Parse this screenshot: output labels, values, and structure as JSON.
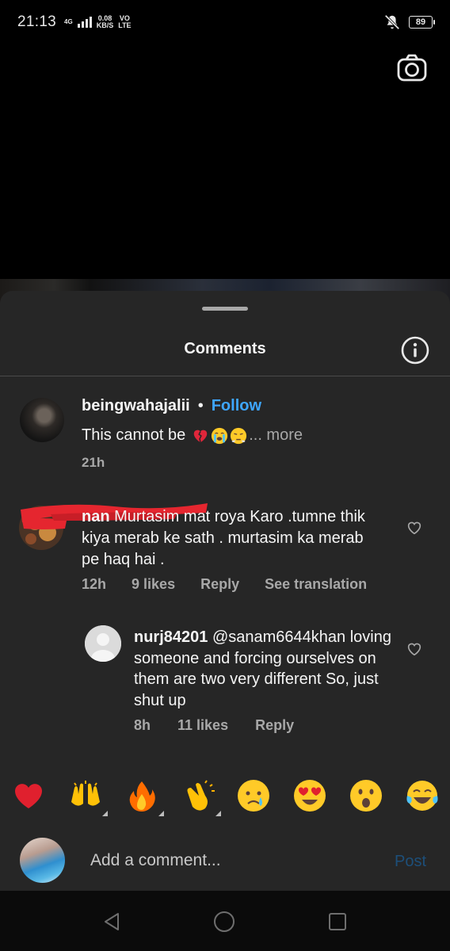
{
  "status_bar": {
    "time": "21:13",
    "network_type": "4G",
    "speed_value": "0.08",
    "speed_unit": "KB/S",
    "volte_top": "VO",
    "volte_bottom": "LTE",
    "battery": "89",
    "icons": [
      "signal-icon",
      "mute-icon",
      "battery-icon"
    ]
  },
  "top": {
    "camera_icon": "camera-icon"
  },
  "sheet": {
    "title": "Comments",
    "info_icon": "info-icon"
  },
  "comments": [
    {
      "username": "beingwahajalii",
      "separator": "•",
      "follow_label": "Follow",
      "text": "This cannot be",
      "emojis": [
        "broken-heart",
        "loudly-crying",
        "steam-from-nose"
      ],
      "more_label": "... more",
      "time": "21h"
    },
    {
      "username_tail": "nan",
      "text": " Murtasim mat roya Karo .tumne thik kiya merab ke sath . murtasim ka merab pe  haq hai .",
      "time": "12h",
      "likes": "9 likes",
      "reply_label": "Reply",
      "translate_label": "See translation"
    },
    {
      "username": "nurj84201",
      "text": " @sanam6644khan loving someone and forcing ourselves on them are two very different So, just shut up",
      "time": "8h",
      "likes": "11 likes",
      "reply_label": "Reply"
    }
  ],
  "reactions": [
    "red-heart",
    "raising-hands",
    "fire",
    "clapping-hands",
    "crying-face",
    "heart-eyes",
    "surprised-face",
    "tears-of-joy"
  ],
  "composer": {
    "placeholder": "Add a comment...",
    "post_label": "Post"
  },
  "nav": {
    "icons": [
      "back-icon",
      "home-icon",
      "recents-icon"
    ]
  },
  "colors": {
    "sheet_bg": "#262626",
    "follow_blue": "#3ea6ff",
    "post_disabled": "#1d4f7a",
    "secondary_text": "#a8a8a8"
  }
}
